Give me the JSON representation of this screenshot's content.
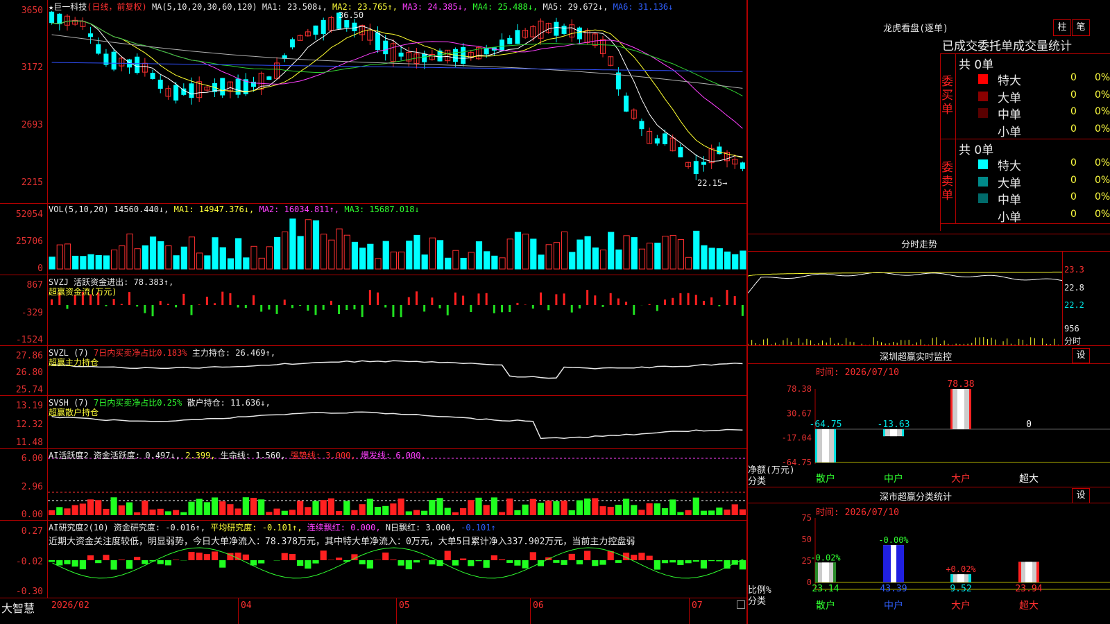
{
  "stock": {
    "title_star": "★",
    "name": "巨一科技",
    "period": "(日线，前复权)",
    "ma_legend": "MA(5,10,20,30,60,120)",
    "ma1": "MA1: 23.508↓,",
    "ma2": "MA2: 23.765↑,",
    "ma3": "MA3: 24.385↓,",
    "ma4": "MA4: 25.488↓,",
    "ma5": "MA5: 29.672↓,",
    "ma6": "MA6: 31.136↓",
    "price_axis": [
      "3650",
      "3172",
      "2693",
      "2215"
    ],
    "high_label": "36.50",
    "low_label": "22.15→"
  },
  "vol": {
    "legend": "VOL(5,10,20)",
    "value": "14560.440↓,",
    "ma1": "MA1: 14947.376↓,",
    "ma2": "MA2: 16034.811↑,",
    "ma3": "MA3: 15687.018↓",
    "axis": [
      "52054",
      "25706",
      "0"
    ]
  },
  "svzj": {
    "legend": "SVZJ  活跃资金进出: 78.383↑,",
    "sub": "超赢资金流(万元)",
    "axis": [
      "867",
      "-329",
      "-1524"
    ]
  },
  "svzl": {
    "legend": "SVZL (7)",
    "pct": "7日内买卖净占比0.183%",
    "hold": "主力持仓: 26.469↑,",
    "sub": "超赢主力持仓",
    "axis": [
      "27.86",
      "26.80",
      "25.74"
    ]
  },
  "svsh": {
    "legend": "SVSH (7)",
    "pct": "7日内买卖净占比0.25%",
    "hold": "散户持仓: 11.636↓,",
    "sub": "超赢散户持仓",
    "axis": [
      "13.19",
      "12.32",
      "11.48"
    ]
  },
  "ai1": {
    "legend": "AI活跃度2",
    "a": "资金活跃度: 0.497↓,",
    "b": "2.399,",
    "c": "生命线: 1.560,",
    "d": "强势线: 3.000,",
    "e": "爆发线: 6.000,",
    "axis": [
      "6.00",
      "2.96",
      "0.00"
    ]
  },
  "ai2": {
    "legend": "AI研究度2(10)",
    "a": "资金研究度: -0.016↑,",
    "b": "平均研究度: -0.101↑,",
    "c": "连续飘红: 0.000,",
    "d": "N日飘红: 3.000,",
    "e": "-0.101↑",
    "note": "近期大资金关注度较低，明显弱势，今日大单净流入：78.378万元，其中特大单净流入：0万元，大单5日累计净入337.902万元，当前主力控盘弱",
    "axis": [
      "0.27",
      "-0.02",
      "-0.30"
    ]
  },
  "bottom": {
    "brand": "大智慧",
    "dates": [
      "2026/02",
      "04",
      "05",
      "06",
      "07"
    ]
  },
  "orders": {
    "title": "龙虎看盘(逐单)",
    "btn_a": "柱",
    "btn_b": "笔",
    "subtitle": "已成交委托单成交量统计",
    "buy_label": "委买单",
    "sell_label": "委卖单",
    "buy_total": "共 0单",
    "sell_total": "共 0单",
    "buy_rows": [
      {
        "name": "特大",
        "val": "0",
        "pct": "0%",
        "color": "#ff0000"
      },
      {
        "name": "大单",
        "val": "0",
        "pct": "0%",
        "color": "#8a0000"
      },
      {
        "name": "中单",
        "val": "0",
        "pct": "0%",
        "color": "#5a0000"
      },
      {
        "name": "小单",
        "val": "0",
        "pct": "0%",
        "color": "#000000"
      }
    ],
    "sell_rows": [
      {
        "name": "特大",
        "val": "0",
        "pct": "0%",
        "color": "#00ffff"
      },
      {
        "name": "大单",
        "val": "0",
        "pct": "0%",
        "color": "#008a8a"
      },
      {
        "name": "中单",
        "val": "0",
        "pct": "0%",
        "color": "#006a6a"
      },
      {
        "name": "小单",
        "val": "0",
        "pct": "0%",
        "color": "#000000"
      }
    ]
  },
  "intraday": {
    "title": "分时走势",
    "price_axis": [
      "23.3",
      "22.8",
      "22.2"
    ],
    "vol_axis": [
      "956",
      "分时"
    ]
  },
  "monitor": {
    "title": "深圳超赢实时监控",
    "btn": "设",
    "time": "时间: 2026/07/10",
    "axis": [
      "78.38",
      "30.67",
      "-17.04",
      "-64.75"
    ],
    "y_caption_a": "净额(万元)",
    "y_caption_b": "分类",
    "categories": [
      "散户",
      "中户",
      "大户",
      "超大"
    ],
    "values": [
      -64.75,
      -13.63,
      78.38,
      0
    ],
    "value_labels": [
      "-64.75",
      "-13.63",
      "78.38",
      "0"
    ]
  },
  "classstat": {
    "title": "深市超赢分类统计",
    "btn": "设",
    "time": "时间: 2026/07/10",
    "axis": [
      "75",
      "50",
      "25",
      "0"
    ],
    "y_caption_a": "比例%",
    "y_caption_b": "分类",
    "categories": [
      "散户",
      "中户",
      "大户",
      "超大"
    ],
    "values": [
      23.14,
      43.39,
      9.52,
      23.94
    ],
    "value_labels": [
      "23.14",
      "43.39",
      "9.52",
      "23.94"
    ],
    "change_labels": [
      "-0.02%",
      "-0.00%",
      "+0.02%",
      ""
    ],
    "colors": [
      "#2a8a2a",
      "#2020e0",
      "#00e0e0",
      "#ff2020"
    ]
  },
  "chart_data": {
    "type": "bar",
    "title": "深市超赢分类统计",
    "categories": [
      "散户",
      "中户",
      "大户",
      "超大"
    ],
    "series": [
      {
        "name": "净额(万元)",
        "values": [
          -64.75,
          -13.63,
          78.38,
          0
        ]
      },
      {
        "name": "比例%",
        "values": [
          23.14,
          43.39,
          9.52,
          23.94
        ]
      }
    ],
    "ylim_net": [
      -64.75,
      78.38
    ],
    "ylim_ratio": [
      0,
      75
    ]
  }
}
